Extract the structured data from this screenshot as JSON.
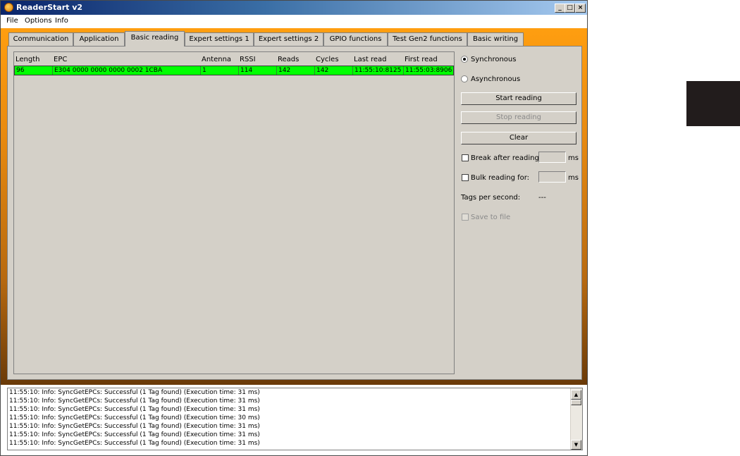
{
  "window": {
    "title": "ReaderStart v2"
  },
  "titlebar_buttons": {
    "minimize": "_",
    "maximize": "□",
    "close": "×"
  },
  "menu": {
    "items": [
      "File",
      "Options",
      "Info"
    ]
  },
  "tabs": [
    "Communication",
    "Application",
    "Basic reading",
    "Expert settings 1",
    "Expert settings 2",
    "GPIO functions",
    "Test Gen2 functions",
    "Basic writing"
  ],
  "active_tab": "Basic reading",
  "table": {
    "headers": [
      "Length",
      "EPC",
      "Antenna",
      "RSSI",
      "Reads",
      "Cycles",
      "Last read",
      "First read"
    ],
    "rows": [
      [
        "96",
        "E304 0000 0000 0000 0002 1CBA",
        "1",
        "114",
        "142",
        "142",
        "11:55:10:8125",
        "11:55:03:8906"
      ]
    ],
    "row_highlight_color": "#00ff00"
  },
  "controls": {
    "synchronous_label": "Synchronous",
    "asynchronous_label": "Asynchronous",
    "start_reading": "Start reading",
    "stop_reading": "Stop reading",
    "clear": "Clear",
    "break_after_reading": "Break after reading:",
    "bulk_reading_for": "Bulk reading for:",
    "ms": "ms",
    "tags_per_second_label": "Tags per second:",
    "tags_per_second_value": "---",
    "save_to_file": "Save to file"
  },
  "log": {
    "lines": [
      "11:55:10: Info: SyncGetEPCs: Successful (1 Tag found) (Execution time: 31 ms)",
      "11:55:10: Info: SyncGetEPCs: Successful (1 Tag found) (Execution time: 31 ms)",
      "11:55:10: Info: SyncGetEPCs: Successful (1 Tag found) (Execution time: 31 ms)",
      "11:55:10: Info: SyncGetEPCs: Successful (1 Tag found) (Execution time: 30 ms)",
      "11:55:10: Info: SyncGetEPCs: Successful (1 Tag found) (Execution time: 31 ms)",
      "11:55:10: Info: SyncGetEPCs: Successful (1 Tag found) (Execution time: 31 ms)",
      "11:55:10: Info: SyncGetEPCs: Successful (1 Tag found) (Execution time: 31 ms)"
    ]
  },
  "colors": {
    "accent_orange": "#ff9e10",
    "title_blue": "#0a246a",
    "panel_gray": "#d4d0c8"
  }
}
